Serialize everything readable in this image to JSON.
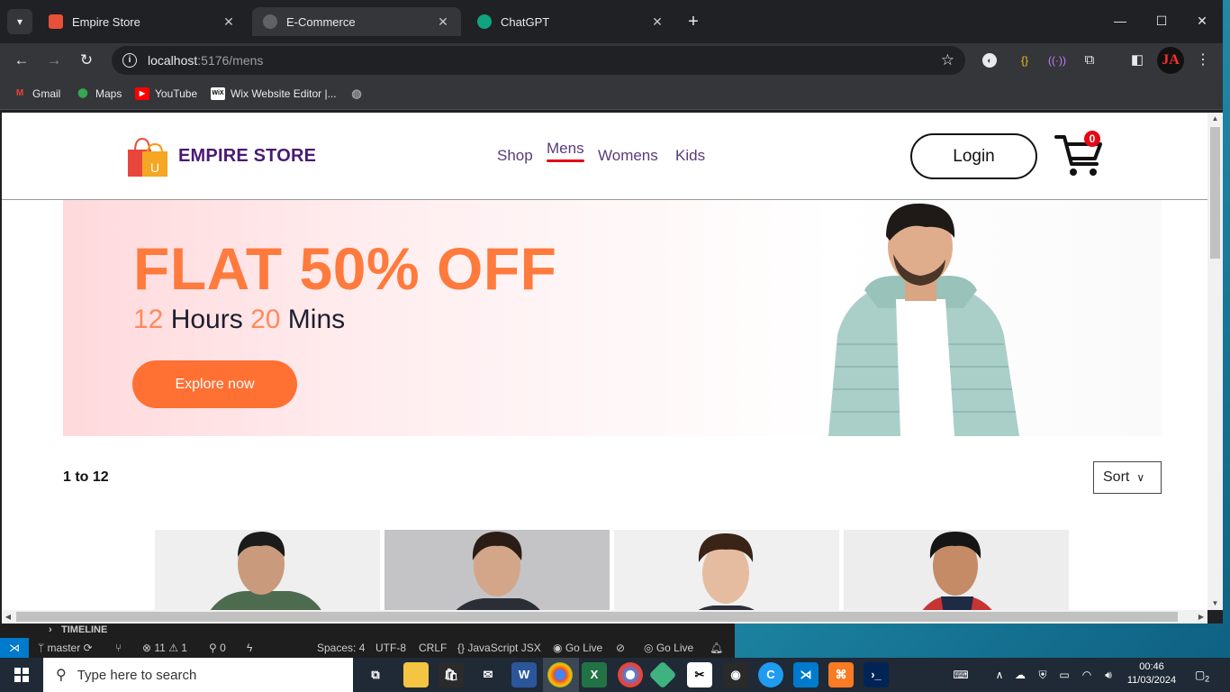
{
  "browser": {
    "tabs": [
      {
        "title": "Empire Store",
        "active": false
      },
      {
        "title": "E-Commerce",
        "active": true
      },
      {
        "title": "ChatGPT",
        "active": false
      }
    ],
    "new_tab_icon": "plus-icon",
    "url_host": "localhost",
    "url_path": ":5176/mens",
    "bookmarks": [
      {
        "label": "Gmail"
      },
      {
        "label": "Maps"
      },
      {
        "label": "YouTube"
      },
      {
        "label": "Wix Website Editor |..."
      }
    ],
    "profile_initials": "JA"
  },
  "site": {
    "brand": "EMPIRE STORE",
    "logo_badge": "U",
    "menu": [
      {
        "label": "Shop"
      },
      {
        "label": "Mens",
        "active": true
      },
      {
        "label": "Womens"
      },
      {
        "label": "Kids"
      }
    ],
    "login_label": "Login",
    "cart_count": "0",
    "accent_color": "#e50914",
    "brand_color": "#4a1a73"
  },
  "hero": {
    "title": "FLAT 50% OFF",
    "hours_value": "12",
    "hours_label": " Hours ",
    "mins_value": "20",
    "mins_label": " Mins",
    "button_label": "Explore now",
    "accent_color": "#ff7033"
  },
  "listing": {
    "results_label": "1 to 12",
    "sort_label": "Sort",
    "product_count_visible": 4
  },
  "vscode": {
    "timeline_label": "TIMELINE",
    "branch": "master",
    "errors": "11",
    "warnings": "1",
    "ports": "0",
    "spaces": "Spaces: 4",
    "encoding": "UTF-8",
    "eol": "CRLF",
    "language": "JavaScript JSX",
    "golive1": "Go Live",
    "golive2": "Go Live"
  },
  "taskbar": {
    "search_placeholder": "Type here to search",
    "time": "00:46",
    "date": "11/03/2024",
    "notifications": "2"
  }
}
